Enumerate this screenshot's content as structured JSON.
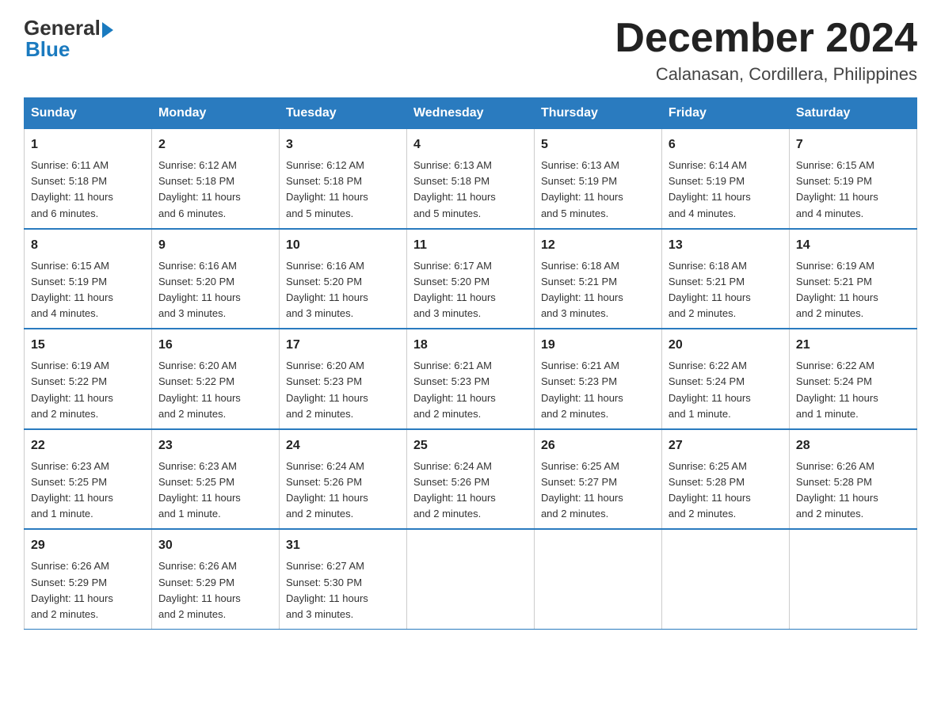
{
  "header": {
    "logo_general": "General",
    "logo_blue": "Blue",
    "month_title": "December 2024",
    "location": "Calanasan, Cordillera, Philippines"
  },
  "days_of_week": [
    "Sunday",
    "Monday",
    "Tuesday",
    "Wednesday",
    "Thursday",
    "Friday",
    "Saturday"
  ],
  "weeks": [
    [
      {
        "day": "1",
        "sunrise": "6:11 AM",
        "sunset": "5:18 PM",
        "daylight": "11 hours and 6 minutes."
      },
      {
        "day": "2",
        "sunrise": "6:12 AM",
        "sunset": "5:18 PM",
        "daylight": "11 hours and 6 minutes."
      },
      {
        "day": "3",
        "sunrise": "6:12 AM",
        "sunset": "5:18 PM",
        "daylight": "11 hours and 5 minutes."
      },
      {
        "day": "4",
        "sunrise": "6:13 AM",
        "sunset": "5:18 PM",
        "daylight": "11 hours and 5 minutes."
      },
      {
        "day": "5",
        "sunrise": "6:13 AM",
        "sunset": "5:19 PM",
        "daylight": "11 hours and 5 minutes."
      },
      {
        "day": "6",
        "sunrise": "6:14 AM",
        "sunset": "5:19 PM",
        "daylight": "11 hours and 4 minutes."
      },
      {
        "day": "7",
        "sunrise": "6:15 AM",
        "sunset": "5:19 PM",
        "daylight": "11 hours and 4 minutes."
      }
    ],
    [
      {
        "day": "8",
        "sunrise": "6:15 AM",
        "sunset": "5:19 PM",
        "daylight": "11 hours and 4 minutes."
      },
      {
        "day": "9",
        "sunrise": "6:16 AM",
        "sunset": "5:20 PM",
        "daylight": "11 hours and 3 minutes."
      },
      {
        "day": "10",
        "sunrise": "6:16 AM",
        "sunset": "5:20 PM",
        "daylight": "11 hours and 3 minutes."
      },
      {
        "day": "11",
        "sunrise": "6:17 AM",
        "sunset": "5:20 PM",
        "daylight": "11 hours and 3 minutes."
      },
      {
        "day": "12",
        "sunrise": "6:18 AM",
        "sunset": "5:21 PM",
        "daylight": "11 hours and 3 minutes."
      },
      {
        "day": "13",
        "sunrise": "6:18 AM",
        "sunset": "5:21 PM",
        "daylight": "11 hours and 2 minutes."
      },
      {
        "day": "14",
        "sunrise": "6:19 AM",
        "sunset": "5:21 PM",
        "daylight": "11 hours and 2 minutes."
      }
    ],
    [
      {
        "day": "15",
        "sunrise": "6:19 AM",
        "sunset": "5:22 PM",
        "daylight": "11 hours and 2 minutes."
      },
      {
        "day": "16",
        "sunrise": "6:20 AM",
        "sunset": "5:22 PM",
        "daylight": "11 hours and 2 minutes."
      },
      {
        "day": "17",
        "sunrise": "6:20 AM",
        "sunset": "5:23 PM",
        "daylight": "11 hours and 2 minutes."
      },
      {
        "day": "18",
        "sunrise": "6:21 AM",
        "sunset": "5:23 PM",
        "daylight": "11 hours and 2 minutes."
      },
      {
        "day": "19",
        "sunrise": "6:21 AM",
        "sunset": "5:23 PM",
        "daylight": "11 hours and 2 minutes."
      },
      {
        "day": "20",
        "sunrise": "6:22 AM",
        "sunset": "5:24 PM",
        "daylight": "11 hours and 1 minute."
      },
      {
        "day": "21",
        "sunrise": "6:22 AM",
        "sunset": "5:24 PM",
        "daylight": "11 hours and 1 minute."
      }
    ],
    [
      {
        "day": "22",
        "sunrise": "6:23 AM",
        "sunset": "5:25 PM",
        "daylight": "11 hours and 1 minute."
      },
      {
        "day": "23",
        "sunrise": "6:23 AM",
        "sunset": "5:25 PM",
        "daylight": "11 hours and 1 minute."
      },
      {
        "day": "24",
        "sunrise": "6:24 AM",
        "sunset": "5:26 PM",
        "daylight": "11 hours and 2 minutes."
      },
      {
        "day": "25",
        "sunrise": "6:24 AM",
        "sunset": "5:26 PM",
        "daylight": "11 hours and 2 minutes."
      },
      {
        "day": "26",
        "sunrise": "6:25 AM",
        "sunset": "5:27 PM",
        "daylight": "11 hours and 2 minutes."
      },
      {
        "day": "27",
        "sunrise": "6:25 AM",
        "sunset": "5:28 PM",
        "daylight": "11 hours and 2 minutes."
      },
      {
        "day": "28",
        "sunrise": "6:26 AM",
        "sunset": "5:28 PM",
        "daylight": "11 hours and 2 minutes."
      }
    ],
    [
      {
        "day": "29",
        "sunrise": "6:26 AM",
        "sunset": "5:29 PM",
        "daylight": "11 hours and 2 minutes."
      },
      {
        "day": "30",
        "sunrise": "6:26 AM",
        "sunset": "5:29 PM",
        "daylight": "11 hours and 2 minutes."
      },
      {
        "day": "31",
        "sunrise": "6:27 AM",
        "sunset": "5:30 PM",
        "daylight": "11 hours and 3 minutes."
      },
      null,
      null,
      null,
      null
    ]
  ],
  "labels": {
    "sunrise": "Sunrise:",
    "sunset": "Sunset:",
    "daylight": "Daylight:"
  }
}
